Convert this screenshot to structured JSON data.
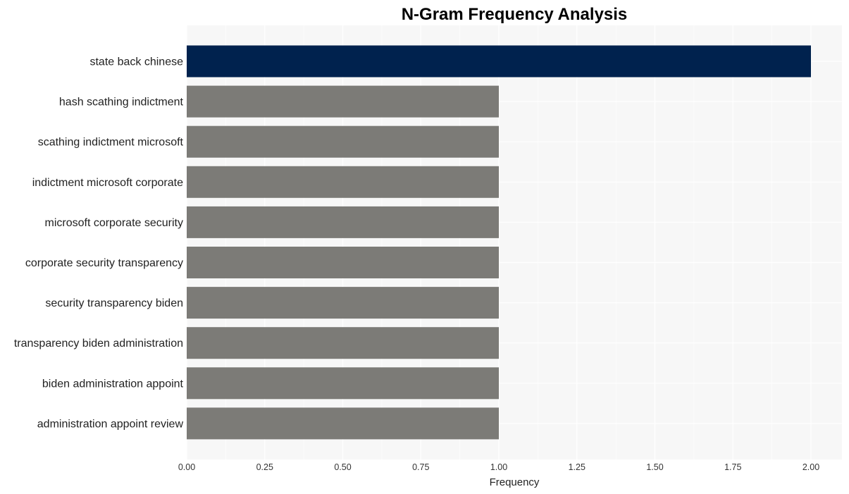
{
  "chart_data": {
    "type": "bar",
    "orientation": "horizontal",
    "title": "N-Gram Frequency Analysis",
    "xlabel": "Frequency",
    "ylabel": "",
    "xlim": [
      0,
      2.1
    ],
    "xticks": [
      0,
      0.25,
      0.5,
      0.75,
      1.0,
      1.25,
      1.5,
      1.75,
      2.0
    ],
    "xtick_labels": [
      "0.00",
      "0.25",
      "0.50",
      "0.75",
      "1.00",
      "1.25",
      "1.50",
      "1.75",
      "2.00"
    ],
    "grid": true,
    "legend": "none",
    "categories": [
      "state back chinese",
      "hash scathing indictment",
      "scathing indictment microsoft",
      "indictment microsoft corporate",
      "microsoft corporate security",
      "corporate security transparency",
      "security transparency biden",
      "transparency biden administration",
      "biden administration appoint",
      "administration appoint review"
    ],
    "values": [
      2,
      1,
      1,
      1,
      1,
      1,
      1,
      1,
      1,
      1
    ],
    "colors": {
      "highlight": "#00224e",
      "default": "#7c7b77",
      "panel": "#f7f7f7",
      "grid": "#ffffff"
    }
  }
}
